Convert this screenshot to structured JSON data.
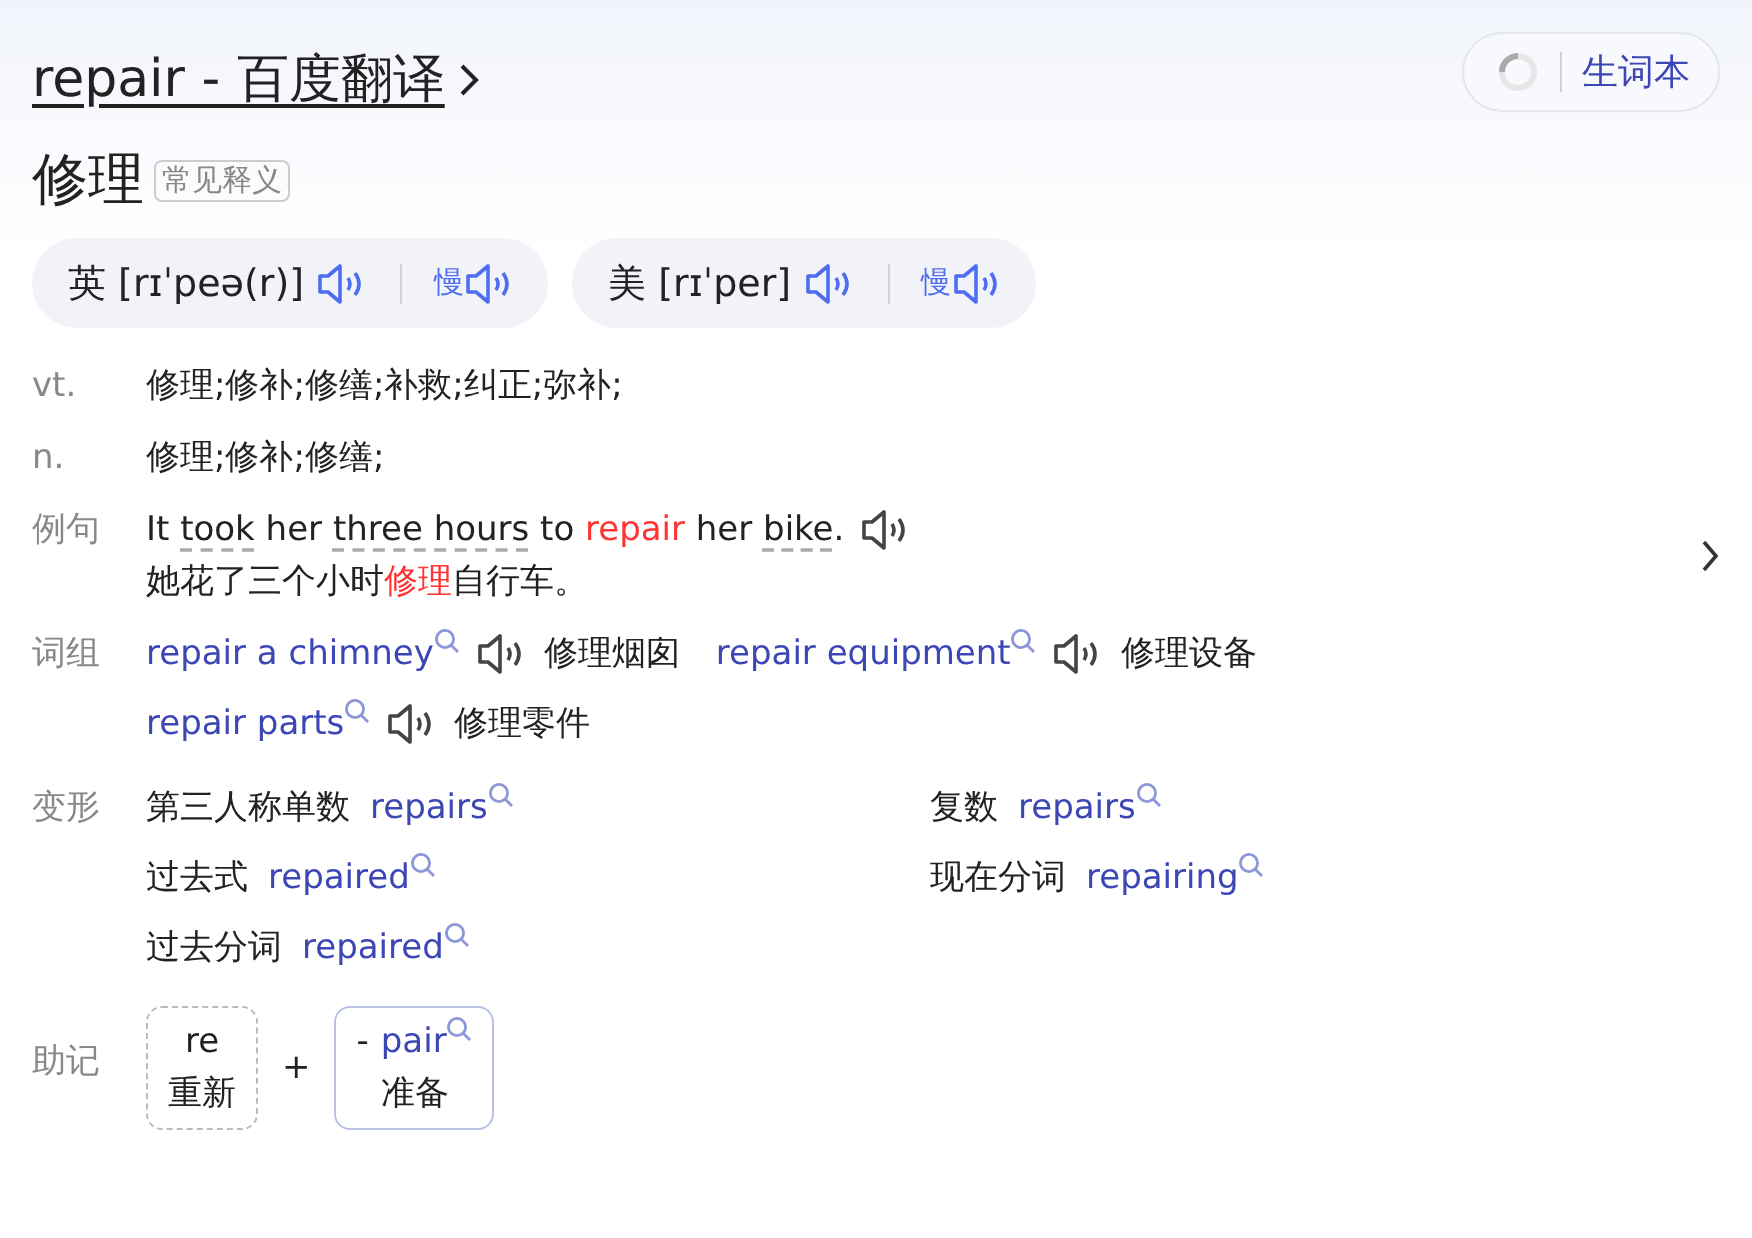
{
  "title": "repair - 百度翻译",
  "wordbook_button": "生词本",
  "headword": "修理",
  "headword_tag": "常见释义",
  "pronunciations": [
    {
      "region": "英",
      "phonetic": "[rɪˈpeə(r)]",
      "slow": "慢"
    },
    {
      "region": "美",
      "phonetic": "[rɪˈper]",
      "slow": "慢"
    }
  ],
  "definitions": [
    {
      "pos": "vt.",
      "meaning": "修理;修补;修缮;补救;纠正;弥补;"
    },
    {
      "pos": "n.",
      "meaning": "修理;修补;修缮;"
    }
  ],
  "example": {
    "label": "例句",
    "sentence": [
      {
        "kind": "plain",
        "text": "It "
      },
      {
        "kind": "word",
        "text": "took"
      },
      {
        "kind": "plain",
        "text": " her "
      },
      {
        "kind": "word",
        "text": "three hours"
      },
      {
        "kind": "plain",
        "text": " to "
      },
      {
        "kind": "highlight",
        "text": "repair"
      },
      {
        "kind": "plain",
        "text": " her "
      },
      {
        "kind": "word",
        "text": "bike"
      },
      {
        "kind": "plain",
        "text": "."
      }
    ],
    "translation": [
      {
        "kind": "plain",
        "text": "她花了三个小时"
      },
      {
        "kind": "highlight",
        "text": "修理"
      },
      {
        "kind": "plain",
        "text": "自行车。"
      }
    ]
  },
  "phrases": {
    "label": "词组",
    "items": [
      {
        "phrase": "repair a chimney",
        "meaning": "修理烟囱"
      },
      {
        "phrase": "repair equipment",
        "meaning": "修理设备"
      },
      {
        "phrase": "repair parts",
        "meaning": "修理零件"
      }
    ]
  },
  "forms": {
    "label": "变形",
    "items": [
      {
        "name": "第三人称单数",
        "word": "repairs"
      },
      {
        "name": "复数",
        "word": "repairs"
      },
      {
        "name": "过去式",
        "word": "repaired"
      },
      {
        "name": "现在分词",
        "word": "repairing"
      },
      {
        "name": "过去分词",
        "word": "repaired"
      }
    ]
  },
  "mnemonic": {
    "label": "助记",
    "joiner": "+",
    "parts": [
      {
        "kind": "prefix",
        "word": "re",
        "meaning": "重新"
      },
      {
        "kind": "root",
        "lead": "-",
        "word": "pair",
        "meaning": "准备"
      }
    ]
  }
}
